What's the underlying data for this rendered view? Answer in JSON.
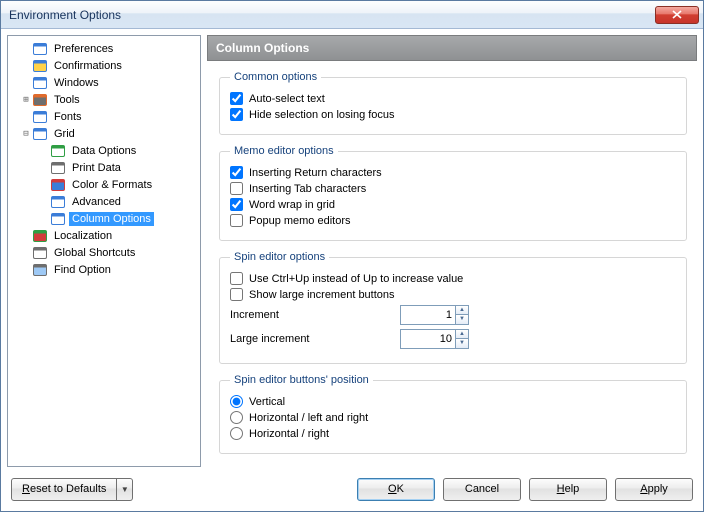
{
  "window": {
    "title": "Environment Options"
  },
  "tree": {
    "items": [
      {
        "label": "Preferences",
        "depth": 0,
        "twisty": "",
        "icon": "prefs",
        "selected": false
      },
      {
        "label": "Confirmations",
        "depth": 0,
        "twisty": "",
        "icon": "confirm",
        "selected": false
      },
      {
        "label": "Windows",
        "depth": 0,
        "twisty": "",
        "icon": "windows",
        "selected": false
      },
      {
        "label": "Tools",
        "depth": 0,
        "twisty": "+",
        "icon": "tools",
        "selected": false
      },
      {
        "label": "Fonts",
        "depth": 0,
        "twisty": "",
        "icon": "fonts",
        "selected": false
      },
      {
        "label": "Grid",
        "depth": 0,
        "twisty": "-",
        "icon": "grid",
        "selected": false
      },
      {
        "label": "Data Options",
        "depth": 1,
        "twisty": "",
        "icon": "data",
        "selected": false
      },
      {
        "label": "Print Data",
        "depth": 1,
        "twisty": "",
        "icon": "print",
        "selected": false
      },
      {
        "label": "Color & Formats",
        "depth": 1,
        "twisty": "",
        "icon": "color",
        "selected": false
      },
      {
        "label": "Advanced",
        "depth": 1,
        "twisty": "",
        "icon": "adv",
        "selected": false
      },
      {
        "label": "Column Options",
        "depth": 1,
        "twisty": "",
        "icon": "col",
        "selected": true
      },
      {
        "label": "Localization",
        "depth": 0,
        "twisty": "",
        "icon": "local",
        "selected": false
      },
      {
        "label": "Global Shortcuts",
        "depth": 0,
        "twisty": "",
        "icon": "short",
        "selected": false
      },
      {
        "label": "Find Option",
        "depth": 0,
        "twisty": "",
        "icon": "find",
        "selected": false
      }
    ]
  },
  "pane": {
    "title": "Column Options",
    "common": {
      "legend": "Common options",
      "auto_select": {
        "label": "Auto-select text",
        "checked": true
      },
      "hide_selection": {
        "label": "Hide selection on losing focus",
        "checked": true
      }
    },
    "memo": {
      "legend": "Memo editor options",
      "ins_return": {
        "label": "Inserting Return characters",
        "checked": true
      },
      "ins_tab": {
        "label": "Inserting Tab characters",
        "checked": false
      },
      "word_wrap": {
        "label": "Word wrap in grid",
        "checked": true
      },
      "popup": {
        "label": "Popup memo editors",
        "checked": false
      }
    },
    "spin": {
      "legend": "Spin editor options",
      "ctrl_up": {
        "label": "Use Ctrl+Up instead of Up to increase value",
        "checked": false
      },
      "large_btns": {
        "label": "Show large increment buttons",
        "checked": false
      },
      "increment": {
        "label": "Increment",
        "value": "1"
      },
      "large_increment": {
        "label": "Large increment",
        "value": "10"
      }
    },
    "position": {
      "legend": "Spin editor buttons' position",
      "options": [
        {
          "label": "Vertical",
          "checked": true
        },
        {
          "label": "Horizontal / left and right",
          "checked": false
        },
        {
          "label": "Horizontal / right",
          "checked": false
        }
      ]
    }
  },
  "footer": {
    "reset": "Reset to Defaults",
    "ok": "OK",
    "cancel": "Cancel",
    "help": "Help",
    "apply": "Apply"
  },
  "icons": {
    "prefs": {
      "c1": "#3b7dd8",
      "c2": "#ffffff"
    },
    "confirm": {
      "c1": "#3b7dd8",
      "c2": "#ffd24a"
    },
    "windows": {
      "c1": "#3b7dd8",
      "c2": "#ffffff"
    },
    "tools": {
      "c1": "#e06a2b",
      "c2": "#6e6e6e"
    },
    "fonts": {
      "c1": "#3b7dd8",
      "c2": "#ffffff"
    },
    "grid": {
      "c1": "#3b7dd8",
      "c2": "#ffffff"
    },
    "data": {
      "c1": "#2f9e44",
      "c2": "#ffffff"
    },
    "print": {
      "c1": "#6e6e6e",
      "c2": "#ffffff"
    },
    "color": {
      "c1": "#d23b3b",
      "c2": "#3b7dd8"
    },
    "adv": {
      "c1": "#3b7dd8",
      "c2": "#ffffff"
    },
    "col": {
      "c1": "#3b7dd8",
      "c2": "#ffffff"
    },
    "local": {
      "c1": "#2f9e44",
      "c2": "#d23b3b"
    },
    "short": {
      "c1": "#6e6e6e",
      "c2": "#ffffff"
    },
    "find": {
      "c1": "#6e6e6e",
      "c2": "#9ec9f5"
    }
  }
}
